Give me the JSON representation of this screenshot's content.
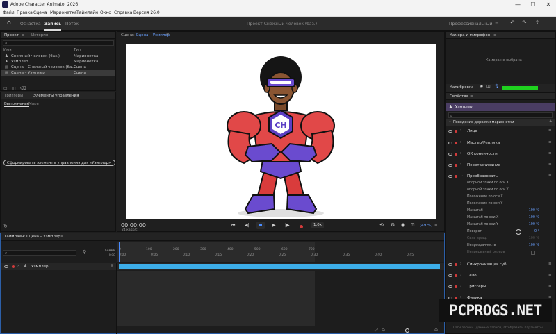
{
  "window": {
    "title": "Adobe Character Animator 2026",
    "controls": [
      "—",
      "☐",
      "✕"
    ]
  },
  "menu": [
    "Файл",
    "Правка",
    "Сцена",
    "Марионетка",
    "Таймлайн",
    "Окно",
    "Справка",
    "Версия 26.0"
  ],
  "appbar": {
    "tabs": [
      "Оснастка",
      "Запись",
      "Поток"
    ],
    "active_tab": "Запись",
    "document_title": "Проект Снежный человек (баз.)",
    "workspace": "Профессиональный"
  },
  "project_panel": {
    "tabs": [
      "Проект",
      "История"
    ],
    "columns": [
      "Имя",
      "Тип"
    ],
    "items": [
      {
        "name": "Снежный человек (баз.)",
        "type": "Марионетка"
      },
      {
        "name": "Уэмплер",
        "type": "Марионетка"
      },
      {
        "name": "Сцена – Снежный человек (ба...",
        "type": "Сцена"
      },
      {
        "name": "Сцена – Уэмплер",
        "type": "Сцена"
      }
    ]
  },
  "triggers_panel": {
    "tabs": [
      "Триггеры",
      "Элементы управления"
    ],
    "subtabs": [
      "Выполнение",
      "Макет"
    ],
    "generate_button": "Сформировать элементы управления для «Уэмплер»"
  },
  "scene_panel": {
    "title_prefix": "Сцена: ",
    "title_link": "Сцена – Уэмплер",
    "timecode": "00:00:00",
    "fps": "24 кадр/с",
    "speed": "1,0x",
    "zoom": "(49 %)",
    "character_badge": "CH"
  },
  "timeline": {
    "title": "Таймлайн: Сцена – Уэмплер",
    "frames_label": "кадры",
    "sec_label": "мсс",
    "ruler_frames": [
      "0",
      "100",
      "200",
      "300",
      "400",
      "500",
      "600",
      "700"
    ],
    "ruler_times": [
      "0:00",
      "0:05",
      "0:10",
      "0:15",
      "0:20",
      "0:25",
      "0:30",
      "0:35",
      "0:40",
      "0:45"
    ],
    "track_name": "Уэмплер"
  },
  "camera_panel": {
    "title": "Камера и микрофон",
    "status": "Камера не выбрана",
    "calibrate": "Калибровка",
    "mic_level": 1.0
  },
  "properties_panel": {
    "title": "Свойства",
    "puppet": "Уэмплер",
    "section": "Поведение дорожки марионетки",
    "behaviors": [
      "Лицо",
      "Мастер/Реплика",
      "ОК конечности",
      "Перетаскивание",
      "Преобразовать"
    ],
    "transform_params": [
      {
        "label": "опорной точки по оси X",
        "value": ""
      },
      {
        "label": "опорной точки по оси Y",
        "value": ""
      },
      {
        "label": "Положение по оси X",
        "value": ""
      },
      {
        "label": "Положение по оси Y",
        "value": ""
      },
      {
        "label": "Масштаб",
        "value": "100 %"
      },
      {
        "label": "Масштаб по оси X",
        "value": "100 %"
      },
      {
        "label": "Масштаб по оси Y",
        "value": "100 %"
      },
      {
        "label": "Поворот",
        "value": "0 °"
      },
      {
        "label": "Сила вращ.",
        "value": "100 %"
      },
      {
        "label": "Непрозрачность",
        "value": "100 %"
      },
      {
        "label": "Непрерывный резерв",
        "value": ""
      }
    ],
    "more_behaviors": [
      "Синхронизация губ",
      "Тело",
      "Триггеры",
      "Физика"
    ],
    "footer": "Шаги записи (данные записи) Отобразить параметры"
  },
  "watermark": "PCPROGS.NET"
}
